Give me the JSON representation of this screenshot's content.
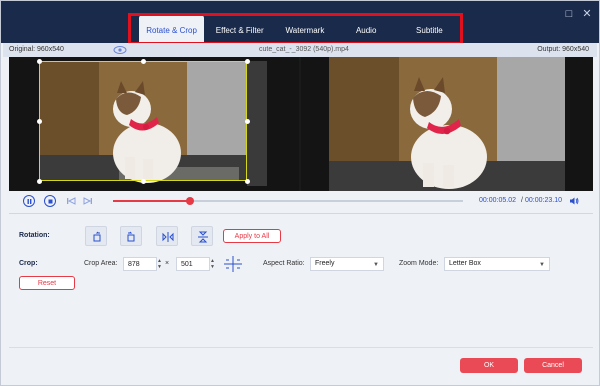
{
  "tabs": [
    "Rotate & Crop",
    "Effect & Filter",
    "Watermark",
    "Audio",
    "Subtitle"
  ],
  "info": {
    "original": "Original: 960x540",
    "filename": "cute_cat_-_3092 (540p).mp4",
    "output": "Output: 960x540"
  },
  "playback": {
    "current_time": "00:00:05.02",
    "separator": "/",
    "total_time": "00:00:23.10",
    "progress": 0.22
  },
  "rotation": {
    "label": "Rotation:",
    "apply_label": "Apply to All"
  },
  "crop": {
    "label": "Crop:",
    "area_label": "Crop Area:",
    "width": "878",
    "times": "×",
    "height": "501",
    "aspect_label": "Aspect Ratio:",
    "aspect_value": "Freely",
    "zoom_label": "Zoom Mode:",
    "zoom_value": "Letter Box",
    "reset_label": "Reset"
  },
  "footer": {
    "ok_label": "OK",
    "cancel_label": "Cancel"
  },
  "colors": {
    "accent": "#2a4fcf",
    "danger": "#e63a46",
    "titlebar": "#1a2a4a"
  }
}
